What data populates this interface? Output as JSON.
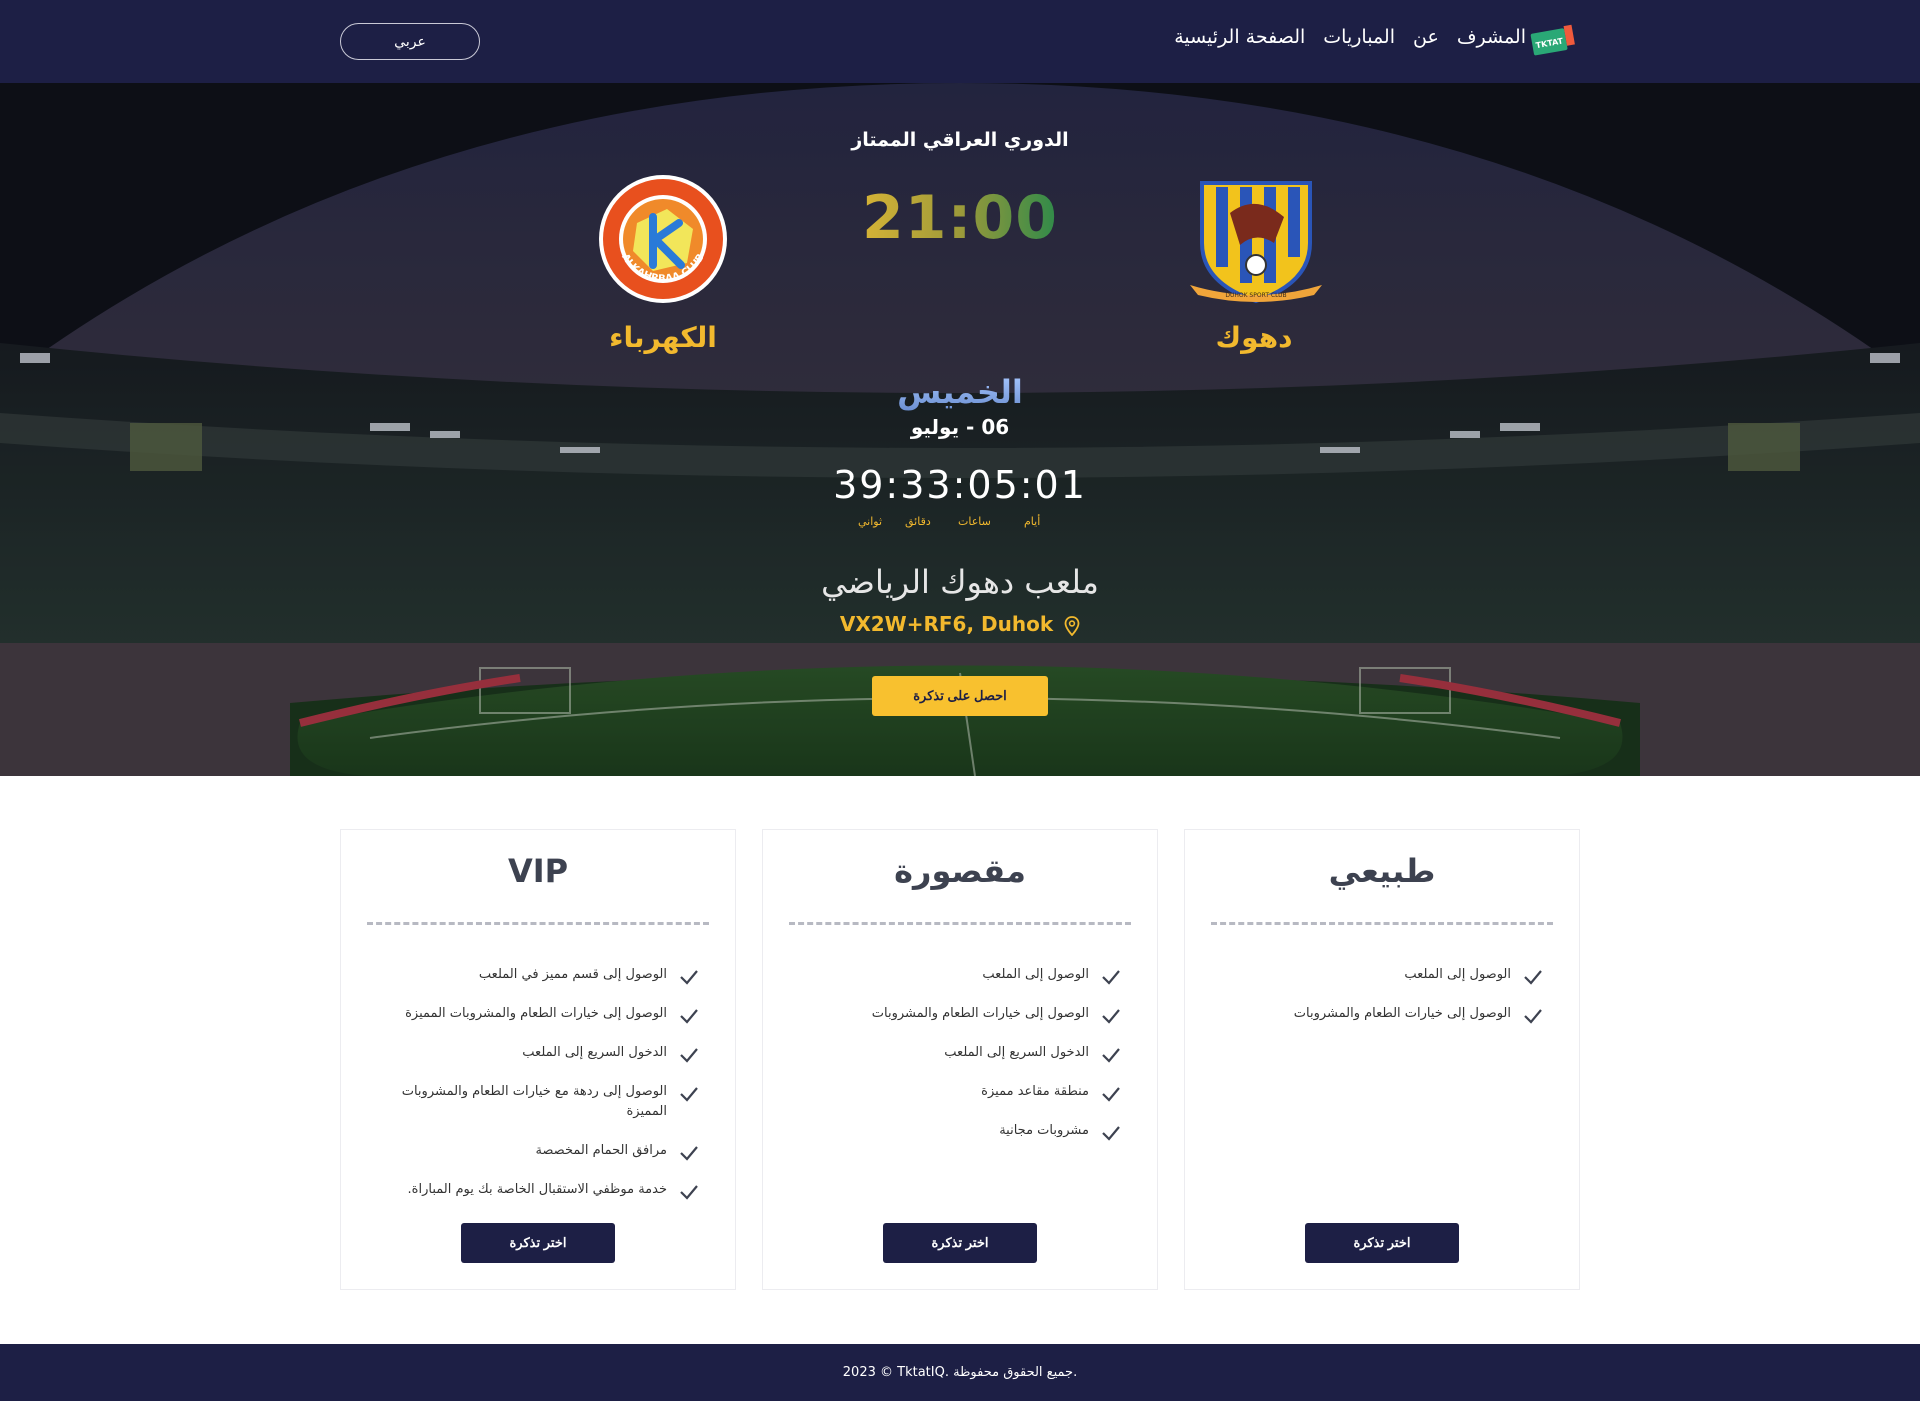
{
  "header": {
    "lang_button": "عربي",
    "nav": [
      "الصفحة الرئيسية",
      "المباريات",
      "عن",
      "المشرف"
    ],
    "logo_text": "TKTAT"
  },
  "match": {
    "league": "الدوري العراقي الممتاز",
    "time": "21:00",
    "home_team": {
      "name": "دهوك",
      "logo_text": "DUHOK SPORT CLUB"
    },
    "away_team": {
      "name": "الكهرباء",
      "logo_text": "ALKAHRBAA CLUB"
    },
    "day": "الخميس",
    "date": "06 - يوليو",
    "countdown": "39:33:05:01",
    "countdown_labels": [
      "أيام",
      "ساعات",
      "دقائق",
      "ثواني"
    ],
    "venue": "ملعب دهوك الرياضي",
    "address": "VX2W+RF6, Duhok",
    "get_ticket": "احصل على تذكرة"
  },
  "tickets": [
    {
      "title": "طبيعي",
      "features": [
        "الوصول إلى الملعب",
        "الوصول إلى خيارات الطعام والمشروبات"
      ],
      "button": "اختر تذكرة"
    },
    {
      "title": "مقصورة",
      "features": [
        "الوصول إلى الملعب",
        "الوصول إلى خيارات الطعام والمشروبات",
        "الدخول السريع إلى الملعب",
        "منطقة مقاعد مميزة",
        "مشروبات مجانية"
      ],
      "button": "اختر تذكرة"
    },
    {
      "title": "VIP",
      "features": [
        "الوصول إلى قسم مميز في الملعب",
        "الوصول إلى خيارات الطعام والمشروبات المميزة",
        "الدخول السريع إلى الملعب",
        "الوصول إلى ردهة مع خيارات الطعام والمشروبات المميزة",
        "مرافق الحمام المخصصة",
        "خدمة موظفي الاستقبال الخاصة بك يوم المباراة."
      ],
      "button": "اختر تذكرة"
    }
  ],
  "footer": {
    "text": "2023 © TktatIQ. جميع الحقوق محفوظة."
  },
  "colors": {
    "navy": "#1d1f45",
    "gold": "#f2b92e",
    "button_yellow": "#f8c12f"
  }
}
